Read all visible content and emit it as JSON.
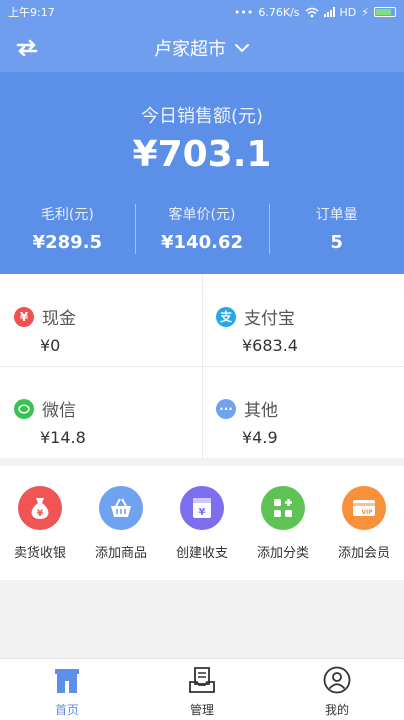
{
  "status_bar": {
    "time": "上午9:17",
    "speed": "6.76K/s",
    "network": "HD"
  },
  "header": {
    "store_name": "卢家超市"
  },
  "sales": {
    "title": "今日销售额(元)",
    "total": "¥703.1",
    "metrics": [
      {
        "label": "毛利(元)",
        "value": "¥289.5"
      },
      {
        "label": "客单价(元)",
        "value": "¥140.62"
      },
      {
        "label": "订单量",
        "value": "5"
      }
    ]
  },
  "payments": [
    {
      "label": "现金",
      "value": "¥0",
      "icon": "yen-icon",
      "color": "#f05050"
    },
    {
      "label": "支付宝",
      "value": "¥683.4",
      "icon": "alipay-icon",
      "color": "#27a7e3"
    },
    {
      "label": "微信",
      "value": "¥14.8",
      "icon": "wechat-icon",
      "color": "#3cc253"
    },
    {
      "label": "其他",
      "value": "¥4.9",
      "icon": "more-icon",
      "color": "#6fa3ef"
    }
  ],
  "actions": [
    {
      "label": "卖货收银",
      "icon": "money-bag-icon",
      "color": "#f05454"
    },
    {
      "label": "添加商品",
      "icon": "basket-icon",
      "color": "#6fa3ef"
    },
    {
      "label": "创建收支",
      "icon": "ledger-icon",
      "color": "#7d6ef0"
    },
    {
      "label": "添加分类",
      "icon": "category-icon",
      "color": "#5fc354"
    },
    {
      "label": "添加会员",
      "icon": "vip-card-icon",
      "color": "#f7913a"
    }
  ],
  "tabs": [
    {
      "label": "首页",
      "icon": "home-icon",
      "active": true
    },
    {
      "label": "管理",
      "icon": "manage-icon",
      "active": false
    },
    {
      "label": "我的",
      "icon": "profile-icon",
      "active": false
    }
  ]
}
